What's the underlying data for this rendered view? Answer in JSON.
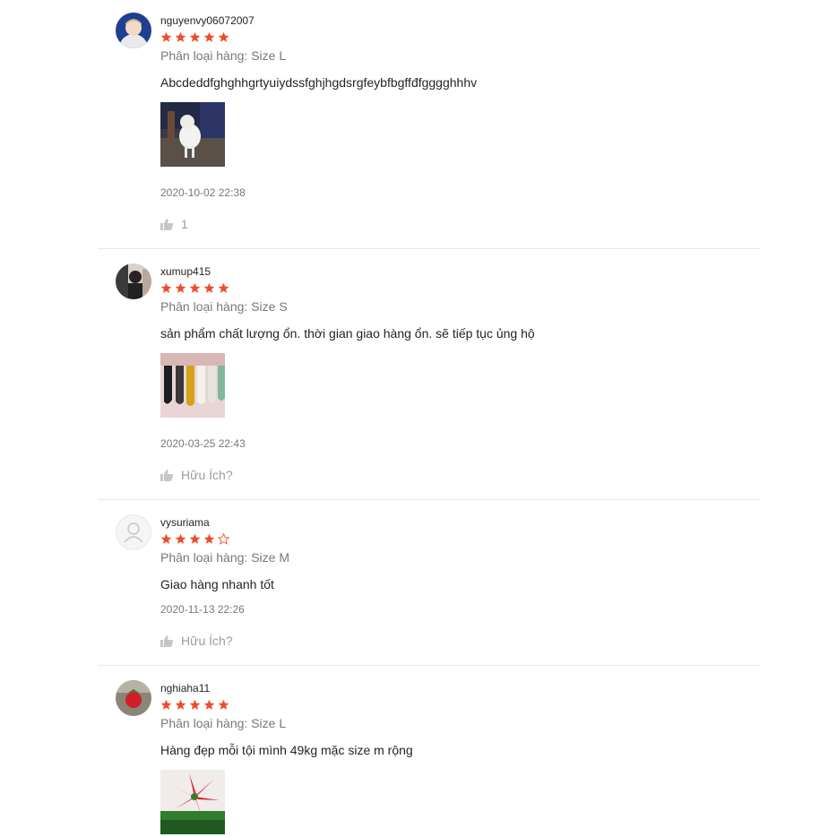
{
  "colors": {
    "star": "#ee4d2d",
    "divider": "#e8e8e8"
  },
  "reviews": [
    {
      "author": "nguyenvy06072007",
      "rating": 5,
      "variation": "Phân loại hàng: Size L",
      "content": "Abcdeddfghghhgrtyuiydssfghjhgdsrgfeybfbgffđfgggghhhv",
      "has_photo": true,
      "photo_name": "review-photo-white-dog",
      "time": "2020-10-02 22:38",
      "like_text": "1",
      "like_icon": "thumbs-up-icon"
    },
    {
      "author": "xumup415",
      "rating": 5,
      "variation": "Phân loại hàng: Size S",
      "content": "sản phẩm chất lượng ổn. thời gian giao hàng ổn. sẽ tiếp tục ủng hộ",
      "has_photo": true,
      "photo_name": "review-photo-socks",
      "time": "2020-03-25 22:43",
      "like_text": "Hữu Ích?",
      "like_icon": "thumbs-up-icon"
    },
    {
      "author": "vysuriama",
      "rating": 4,
      "variation": "Phân loại hàng: Size M",
      "content": "Giao hàng nhanh tốt",
      "has_photo": false,
      "time": "2020-11-13 22:26",
      "like_text": "Hữu Ích?",
      "like_icon": "thumbs-up-icon"
    },
    {
      "author": "nghiaha11",
      "rating": 5,
      "variation": "Phân loại hàng: Size L",
      "content": "Hàng đẹp mỗi tội mình 49kg mặc size m rộng",
      "has_photo": true,
      "photo_name": "review-photo-red-flower",
      "time": "",
      "like_text": "",
      "like_icon": "thumbs-up-icon"
    }
  ]
}
